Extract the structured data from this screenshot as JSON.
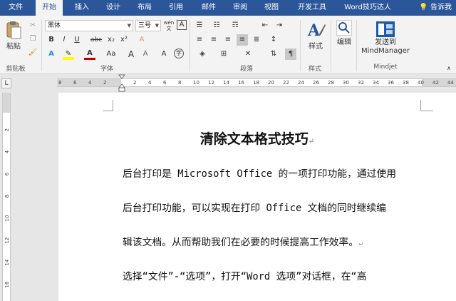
{
  "tabs": [
    {
      "label": "文件",
      "active": false
    },
    {
      "label": "开始",
      "active": true
    },
    {
      "label": "插入",
      "active": false
    },
    {
      "label": "设计",
      "active": false
    },
    {
      "label": "布局",
      "active": false
    },
    {
      "label": "引用",
      "active": false
    },
    {
      "label": "邮件",
      "active": false
    },
    {
      "label": "审阅",
      "active": false
    },
    {
      "label": "视图",
      "active": false
    },
    {
      "label": "开发工具",
      "active": false
    },
    {
      "label": "Word技巧达人",
      "active": false
    }
  ],
  "tell_me": "告诉我",
  "ribbon": {
    "clipboard": {
      "paste": "粘贴",
      "group": "剪贴板"
    },
    "font": {
      "name": "黑体",
      "size": "三号",
      "wen_glyph": "wén",
      "group": "字体",
      "bold": "B",
      "italic": "I",
      "underline": "U",
      "strike": "abc",
      "sub": "x₂",
      "sup": "x²",
      "clear": "A",
      "text_effect": "A",
      "font_color": "A",
      "case": "Aa",
      "grow": "A",
      "phonetic": "A",
      "enclose": "字"
    },
    "paragraph": {
      "group": "段落"
    },
    "styles": {
      "label": "样式",
      "group": "样式"
    },
    "editing": {
      "label": "编辑"
    },
    "mindjet": {
      "line1": "发送到",
      "line2": "MindManager",
      "group": "Mindjet"
    }
  },
  "colors": {
    "accent": "#2b579a",
    "highlight_yellow": "#ffff00",
    "font_red": "#c00000"
  },
  "ruler": {
    "corner": "L",
    "ticks": [
      "8",
      "6",
      "4",
      "2",
      "2",
      "4",
      "6",
      "8",
      "10",
      "12",
      "14",
      "16",
      "18",
      "20",
      "22",
      "24",
      "26",
      "28",
      "30",
      "32",
      "34",
      "36",
      "38",
      "40",
      "42",
      "44"
    ],
    "vticks": [
      "2",
      "4",
      "6",
      "8",
      "10",
      "12",
      "14",
      "16"
    ]
  },
  "document": {
    "title": "清除文本格式技巧",
    "lines": [
      "后台打印是 Microsoft Office 的一项打印功能，通过使用",
      "后台打印功能，可以实现在打印 Office 文档的同时继续编",
      "辑该文档。从而帮助我们在必要的时候提高工作效率。",
      "选择“文件”-“选项”，打开“Word 选项”对话框，在“高"
    ],
    "para_mark": "↵"
  }
}
